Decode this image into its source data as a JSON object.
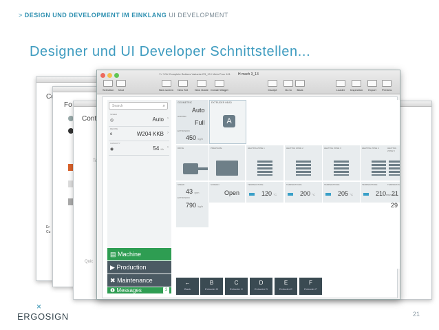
{
  "breadcrumb": {
    "chevron": ">",
    "bold": "DESIGN UND DEVELOPMENT IM EINKLANG",
    "light": "UI DEVELOPMENT"
  },
  "title": "Designer und UI Developer Schnittstellen...",
  "page_number": "21",
  "logo": {
    "mark": "×",
    "word": "ERGOSIGN"
  },
  "bg_labels": {
    "win1": "Co",
    "win2": "Fo",
    "win3": "Contr",
    "win3_to": "To",
    "win3_quic": "Quic",
    "win1_er": "Er",
    "win1_cu": "Cu"
  },
  "window": {
    "title": "H mach 3_13",
    "subtitle": "Y:/ Y/IU Complete Buttons Variante E3_13 / Mein Proc 101",
    "toolbar": [
      {
        "label": "Selection"
      },
      {
        "label": "Mod"
      },
      {
        "label": "New screen"
      },
      {
        "label": "New Set"
      },
      {
        "label": "New Guide"
      },
      {
        "label": "Create Widget"
      },
      {
        "label": "Inscript"
      },
      {
        "label": "Go to"
      },
      {
        "label": "Back"
      },
      {
        "label": "Loader"
      },
      {
        "label": "Inspection"
      },
      {
        "label": "Export"
      },
      {
        "label": "Preview"
      }
    ]
  },
  "sidebar": {
    "search_placeholder": "Search",
    "rows": [
      {
        "caption": "SPEED",
        "icon": "◎",
        "value": "Auto"
      },
      {
        "caption": "RECIPE",
        "icon": "e",
        "value": "W204 KKB"
      },
      {
        "caption": "CAPACITY",
        "icon": "◉",
        "value": "54",
        "unit": "t/h"
      }
    ],
    "nav": [
      {
        "label": "Machine",
        "icon": "▤"
      },
      {
        "label": "Production",
        "icon": "▶"
      },
      {
        "label": "Maintenance",
        "icon": "✖"
      },
      {
        "label": "Messages",
        "icon": "❶",
        "badge": "3"
      }
    ]
  },
  "grid": {
    "geometric_header": "GEOMETRIC",
    "extruder_head": "EXTRUDER HEAD",
    "geo_values": [
      "Auto",
      "Full"
    ],
    "geo_caps": [
      "",
      "HOPPER"
    ],
    "extrusion_cap": "EXTRUSION",
    "extrusion_value": "450",
    "extrusion_unit": "kg/h",
    "zone_headers": [
      "PRESSURE",
      "HEATING ZONE 1",
      "HEATING ZONE 2",
      "HEATING ZONE 3",
      "HEATING ZONE 4",
      "HEATING ZONE 5"
    ],
    "motor_cap": "DRIVE",
    "screen_cap": "SCREEN",
    "screen_value": "Open",
    "temp_caps": [
      "TEMPERATURE",
      "TEMPERATURE",
      "TEMPERATURE",
      "TEMPERATURE",
      "TEMPERATURE"
    ],
    "temps": [
      "120",
      "200",
      "205",
      "210",
      "21"
    ],
    "temp_unit": "°C",
    "speed_cap": "SPEED",
    "speed_value": "43",
    "speed_unit": "rpm",
    "pressure_cap": "PRESSURE",
    "pressure_value": "29",
    "extrusion2_cap": "EXTRUSION",
    "extrusion2_value": "790",
    "extrusion2_unit": "kg/h"
  },
  "bottom_buttons": [
    {
      "icon": "←",
      "label": "Back"
    },
    {
      "icon": "B",
      "label": "Extruder B"
    },
    {
      "icon": "C",
      "label": "Extruder C"
    },
    {
      "icon": "D",
      "label": "Extruder D"
    },
    {
      "icon": "E",
      "label": "Extruder E"
    },
    {
      "icon": "F",
      "label": "Extruder F"
    }
  ],
  "colors": {
    "accent": "#3d9bbf",
    "nav_green": "#2e9d52",
    "nav_dark": "#4b5a63",
    "button_dark": "#3a4a52"
  }
}
